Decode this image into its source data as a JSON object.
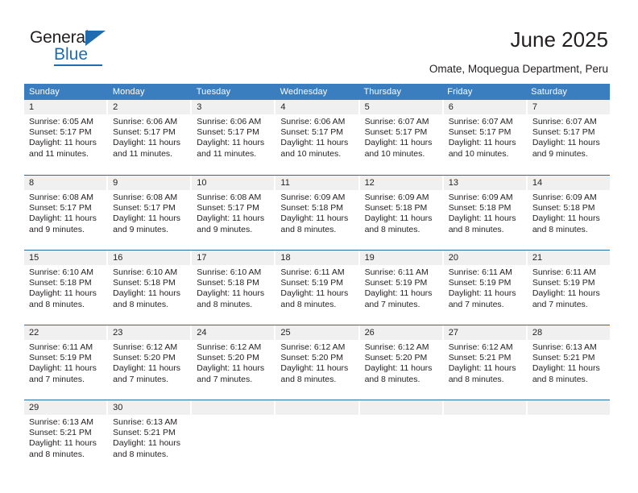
{
  "brand": {
    "name_top": "General",
    "name_bottom": "Blue",
    "triangle_color": "#1f6cb0",
    "accent_color": "#1f6cb0"
  },
  "header": {
    "title": "June 2025",
    "subtitle": "Omate, Moquegua Department, Peru"
  },
  "calendar": {
    "header_bg": "#3b7ebf",
    "daynum_bg": "#f0f0f0",
    "row_divider_color": "#2c6ca4",
    "weekdays": [
      "Sunday",
      "Monday",
      "Tuesday",
      "Wednesday",
      "Thursday",
      "Friday",
      "Saturday"
    ],
    "weeks": [
      [
        {
          "day": "1",
          "sunrise": "Sunrise: 6:05 AM",
          "sunset": "Sunset: 5:17 PM",
          "daylight_1": "Daylight: 11 hours",
          "daylight_2": "and 11 minutes."
        },
        {
          "day": "2",
          "sunrise": "Sunrise: 6:06 AM",
          "sunset": "Sunset: 5:17 PM",
          "daylight_1": "Daylight: 11 hours",
          "daylight_2": "and 11 minutes."
        },
        {
          "day": "3",
          "sunrise": "Sunrise: 6:06 AM",
          "sunset": "Sunset: 5:17 PM",
          "daylight_1": "Daylight: 11 hours",
          "daylight_2": "and 11 minutes."
        },
        {
          "day": "4",
          "sunrise": "Sunrise: 6:06 AM",
          "sunset": "Sunset: 5:17 PM",
          "daylight_1": "Daylight: 11 hours",
          "daylight_2": "and 10 minutes."
        },
        {
          "day": "5",
          "sunrise": "Sunrise: 6:07 AM",
          "sunset": "Sunset: 5:17 PM",
          "daylight_1": "Daylight: 11 hours",
          "daylight_2": "and 10 minutes."
        },
        {
          "day": "6",
          "sunrise": "Sunrise: 6:07 AM",
          "sunset": "Sunset: 5:17 PM",
          "daylight_1": "Daylight: 11 hours",
          "daylight_2": "and 10 minutes."
        },
        {
          "day": "7",
          "sunrise": "Sunrise: 6:07 AM",
          "sunset": "Sunset: 5:17 PM",
          "daylight_1": "Daylight: 11 hours",
          "daylight_2": "and 9 minutes."
        }
      ],
      [
        {
          "day": "8",
          "sunrise": "Sunrise: 6:08 AM",
          "sunset": "Sunset: 5:17 PM",
          "daylight_1": "Daylight: 11 hours",
          "daylight_2": "and 9 minutes."
        },
        {
          "day": "9",
          "sunrise": "Sunrise: 6:08 AM",
          "sunset": "Sunset: 5:17 PM",
          "daylight_1": "Daylight: 11 hours",
          "daylight_2": "and 9 minutes."
        },
        {
          "day": "10",
          "sunrise": "Sunrise: 6:08 AM",
          "sunset": "Sunset: 5:17 PM",
          "daylight_1": "Daylight: 11 hours",
          "daylight_2": "and 9 minutes."
        },
        {
          "day": "11",
          "sunrise": "Sunrise: 6:09 AM",
          "sunset": "Sunset: 5:18 PM",
          "daylight_1": "Daylight: 11 hours",
          "daylight_2": "and 8 minutes."
        },
        {
          "day": "12",
          "sunrise": "Sunrise: 6:09 AM",
          "sunset": "Sunset: 5:18 PM",
          "daylight_1": "Daylight: 11 hours",
          "daylight_2": "and 8 minutes."
        },
        {
          "day": "13",
          "sunrise": "Sunrise: 6:09 AM",
          "sunset": "Sunset: 5:18 PM",
          "daylight_1": "Daylight: 11 hours",
          "daylight_2": "and 8 minutes."
        },
        {
          "day": "14",
          "sunrise": "Sunrise: 6:09 AM",
          "sunset": "Sunset: 5:18 PM",
          "daylight_1": "Daylight: 11 hours",
          "daylight_2": "and 8 minutes."
        }
      ],
      [
        {
          "day": "15",
          "sunrise": "Sunrise: 6:10 AM",
          "sunset": "Sunset: 5:18 PM",
          "daylight_1": "Daylight: 11 hours",
          "daylight_2": "and 8 minutes."
        },
        {
          "day": "16",
          "sunrise": "Sunrise: 6:10 AM",
          "sunset": "Sunset: 5:18 PM",
          "daylight_1": "Daylight: 11 hours",
          "daylight_2": "and 8 minutes."
        },
        {
          "day": "17",
          "sunrise": "Sunrise: 6:10 AM",
          "sunset": "Sunset: 5:18 PM",
          "daylight_1": "Daylight: 11 hours",
          "daylight_2": "and 8 minutes."
        },
        {
          "day": "18",
          "sunrise": "Sunrise: 6:11 AM",
          "sunset": "Sunset: 5:19 PM",
          "daylight_1": "Daylight: 11 hours",
          "daylight_2": "and 8 minutes."
        },
        {
          "day": "19",
          "sunrise": "Sunrise: 6:11 AM",
          "sunset": "Sunset: 5:19 PM",
          "daylight_1": "Daylight: 11 hours",
          "daylight_2": "and 7 minutes."
        },
        {
          "day": "20",
          "sunrise": "Sunrise: 6:11 AM",
          "sunset": "Sunset: 5:19 PM",
          "daylight_1": "Daylight: 11 hours",
          "daylight_2": "and 7 minutes."
        },
        {
          "day": "21",
          "sunrise": "Sunrise: 6:11 AM",
          "sunset": "Sunset: 5:19 PM",
          "daylight_1": "Daylight: 11 hours",
          "daylight_2": "and 7 minutes."
        }
      ],
      [
        {
          "day": "22",
          "sunrise": "Sunrise: 6:11 AM",
          "sunset": "Sunset: 5:19 PM",
          "daylight_1": "Daylight: 11 hours",
          "daylight_2": "and 7 minutes."
        },
        {
          "day": "23",
          "sunrise": "Sunrise: 6:12 AM",
          "sunset": "Sunset: 5:20 PM",
          "daylight_1": "Daylight: 11 hours",
          "daylight_2": "and 7 minutes."
        },
        {
          "day": "24",
          "sunrise": "Sunrise: 6:12 AM",
          "sunset": "Sunset: 5:20 PM",
          "daylight_1": "Daylight: 11 hours",
          "daylight_2": "and 7 minutes."
        },
        {
          "day": "25",
          "sunrise": "Sunrise: 6:12 AM",
          "sunset": "Sunset: 5:20 PM",
          "daylight_1": "Daylight: 11 hours",
          "daylight_2": "and 8 minutes."
        },
        {
          "day": "26",
          "sunrise": "Sunrise: 6:12 AM",
          "sunset": "Sunset: 5:20 PM",
          "daylight_1": "Daylight: 11 hours",
          "daylight_2": "and 8 minutes."
        },
        {
          "day": "27",
          "sunrise": "Sunrise: 6:12 AM",
          "sunset": "Sunset: 5:21 PM",
          "daylight_1": "Daylight: 11 hours",
          "daylight_2": "and 8 minutes."
        },
        {
          "day": "28",
          "sunrise": "Sunrise: 6:13 AM",
          "sunset": "Sunset: 5:21 PM",
          "daylight_1": "Daylight: 11 hours",
          "daylight_2": "and 8 minutes."
        }
      ],
      [
        {
          "day": "29",
          "sunrise": "Sunrise: 6:13 AM",
          "sunset": "Sunset: 5:21 PM",
          "daylight_1": "Daylight: 11 hours",
          "daylight_2": "and 8 minutes."
        },
        {
          "day": "30",
          "sunrise": "Sunrise: 6:13 AM",
          "sunset": "Sunset: 5:21 PM",
          "daylight_1": "Daylight: 11 hours",
          "daylight_2": "and 8 minutes."
        },
        {
          "day": "",
          "sunrise": "",
          "sunset": "",
          "daylight_1": "",
          "daylight_2": ""
        },
        {
          "day": "",
          "sunrise": "",
          "sunset": "",
          "daylight_1": "",
          "daylight_2": ""
        },
        {
          "day": "",
          "sunrise": "",
          "sunset": "",
          "daylight_1": "",
          "daylight_2": ""
        },
        {
          "day": "",
          "sunrise": "",
          "sunset": "",
          "daylight_1": "",
          "daylight_2": ""
        },
        {
          "day": "",
          "sunrise": "",
          "sunset": "",
          "daylight_1": "",
          "daylight_2": ""
        }
      ]
    ]
  }
}
